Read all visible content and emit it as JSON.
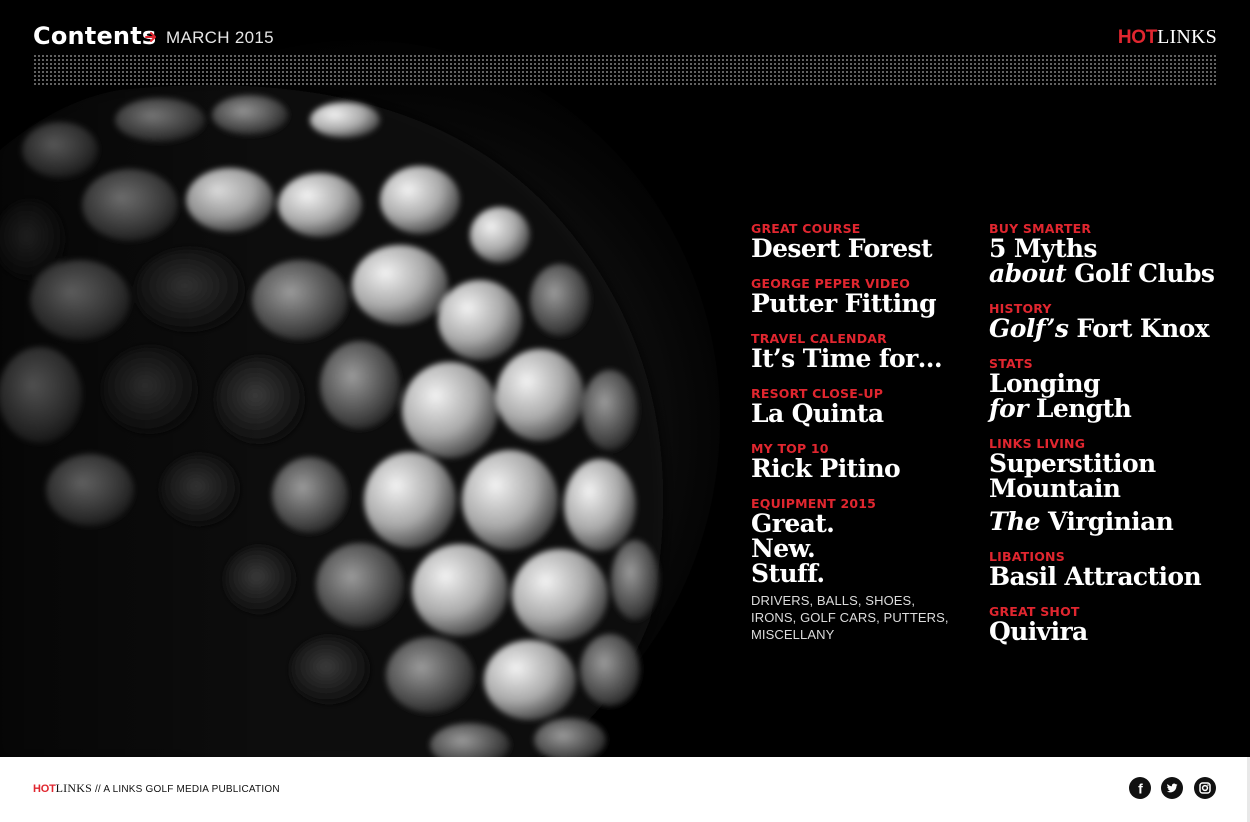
{
  "header": {
    "title": "Contents",
    "arrow_icon": "arrow-right-icon",
    "issue": "MARCH 2015",
    "brand_hot": "HOT",
    "brand_links": "LINKS"
  },
  "toc": {
    "left": [
      {
        "kicker": "GREAT COURSE",
        "headline": "Desert Forest"
      },
      {
        "kicker": "GEORGE PEPER VIDEO",
        "headline": "Putter Fitting"
      },
      {
        "kicker": "TRAVEL CALENDAR",
        "headline": "It’s Time for…"
      },
      {
        "kicker": "RESORT CLOSE-UP",
        "headline": "La Quinta"
      },
      {
        "kicker": "MY TOP 10",
        "headline": "Rick Pitino"
      },
      {
        "kicker": "EQUIPMENT 2015",
        "headline_lines": [
          "Great.",
          "New.",
          "Stuff."
        ],
        "subtext_lines": [
          "DRIVERS, BALLS, SHOES,",
          "IRONS, GOLF CARS, PUTTERS,",
          "MISCELLANY"
        ]
      }
    ],
    "right": [
      {
        "kicker": "BUY SMARTER",
        "line1": "5 Myths",
        "line2_italic": "about",
        "line2_rest": " Golf Clubs"
      },
      {
        "kicker": "HISTORY",
        "italic": "Golf’s",
        "rest": " Fort Knox"
      },
      {
        "kicker": "STATS",
        "line1": "Longing",
        "line2_italic": "for",
        "line2_rest": " Length"
      },
      {
        "kicker": "LINKS LIVING",
        "line1": "Superstition",
        "line2": "Mountain",
        "extra_italic": "The",
        "extra_rest": " Virginian"
      },
      {
        "kicker": "LIBATIONS",
        "headline": "Basil Attraction"
      },
      {
        "kicker": "GREAT SHOT",
        "headline": "Quivira"
      }
    ]
  },
  "footer": {
    "brand_hot": "HOT",
    "brand_links": "LINKS",
    "tagline": " // A LINKS GOLF MEDIA PUBLICATION",
    "social": [
      {
        "name": "facebook",
        "icon": "facebook-icon",
        "glyph": "f"
      },
      {
        "name": "twitter",
        "icon": "twitter-icon"
      },
      {
        "name": "instagram",
        "icon": "instagram-icon"
      }
    ]
  },
  "colors": {
    "accent": "#e0262f",
    "background": "#000000",
    "text": "#ffffff",
    "footer_bg": "#ffffff"
  }
}
